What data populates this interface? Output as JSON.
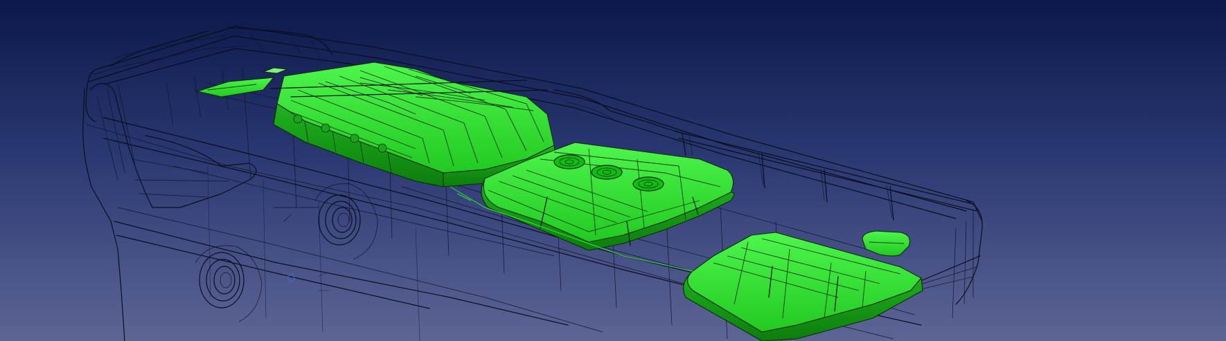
{
  "viewport": {
    "background_top": "#0c1849",
    "background_bottom": "#5d6595",
    "wireframe_color": "#0a0d1c",
    "highlight_color": "#2ee82e",
    "highlight_shade": "#119d11"
  },
  "scene": {
    "model": "bus-wireframe",
    "highlighted_parts": [
      "roof-battery-pack-front",
      "roof-ac-unit",
      "roof-battery-pack-rear",
      "roof-small-cover-front",
      "roof-small-cover-rear"
    ]
  }
}
